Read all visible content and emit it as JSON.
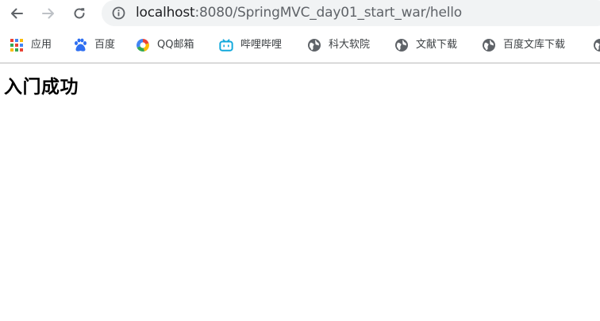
{
  "browser": {
    "url_host": "localhost",
    "url_path": ":8080/SpringMVC_day01_start_war/hello"
  },
  "bookmarks": [
    {
      "label": "应用",
      "icon": "apps-grid-icon"
    },
    {
      "label": "百度",
      "icon": "baidu-paw-icon"
    },
    {
      "label": "QQ邮箱",
      "icon": "qq-mail-icon"
    },
    {
      "label": "哔哩哔哩",
      "icon": "bilibili-tv-icon"
    },
    {
      "label": "科大软院",
      "icon": "globe-icon"
    },
    {
      "label": "文献下载",
      "icon": "globe-icon"
    },
    {
      "label": "百度文库下载",
      "icon": "globe-icon"
    }
  ],
  "colors": {
    "omnibox_bg": "#f1f3f4",
    "icon_gray": "#5f6368",
    "disabled_gray": "#bdc1c6",
    "baidu_blue": "#2f6ff1",
    "bilibili_cyan": "#12a9dc"
  },
  "page": {
    "heading": "入门成功"
  }
}
